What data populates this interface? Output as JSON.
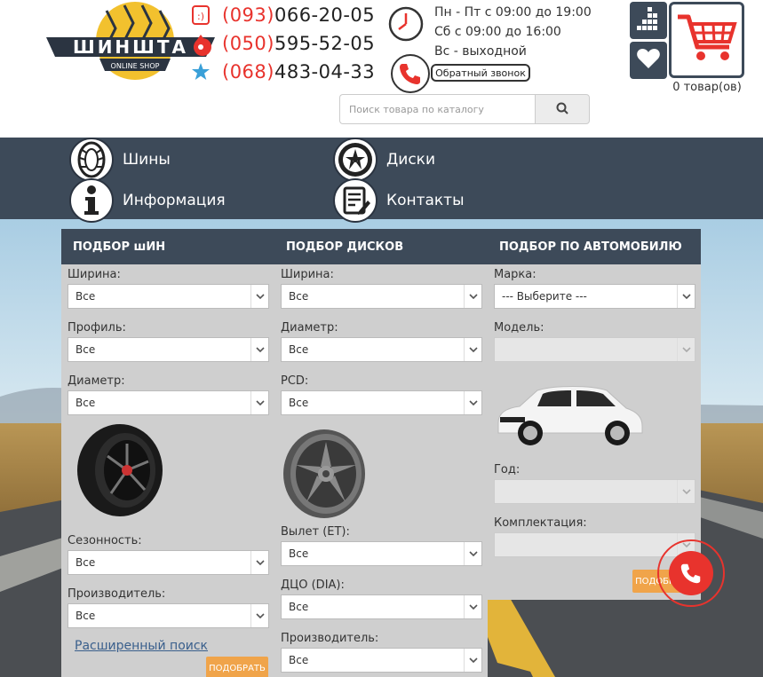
{
  "header": {
    "logo": {
      "text": "ШИНШТА",
      "subtitle": "ONLINE SHOP"
    },
    "phones": [
      {
        "code": "(093)",
        "number": "066-20-05",
        "icon": "smile-icon"
      },
      {
        "code": "(050)",
        "number": "595-52-05",
        "icon": "drop-icon"
      },
      {
        "code": "(068)",
        "number": "483-04-33",
        "icon": "star-icon"
      }
    ],
    "hours": [
      "Пн - Пт с 09:00 до 19:00",
      "Сб с 09:00 до 16:00",
      "Вс - выходной"
    ],
    "callback_label": "Обратный звонок",
    "cart_count_label": "0 товар(ов)",
    "search_placeholder": "Поиск товара по каталогу",
    "colors": {
      "accent": "#e8332d",
      "nav": "#3d4a59"
    }
  },
  "nav": {
    "items": [
      {
        "label": "Шины",
        "icon": "tire-icon"
      },
      {
        "label": "Диски",
        "icon": "wheel-rim-icon"
      },
      {
        "label": "Информация",
        "icon": "info-icon"
      },
      {
        "label": "Контакты",
        "icon": "contacts-icon"
      }
    ]
  },
  "tires": {
    "title": "ПОДБОР шИН",
    "width": {
      "label": "Ширина:",
      "value": "Все"
    },
    "profile": {
      "label": "Профиль:",
      "value": "Все"
    },
    "diameter": {
      "label": "Диаметр:",
      "value": "Все"
    },
    "season": {
      "label": "Сезонность:",
      "value": "Все"
    },
    "maker": {
      "label": "Производитель:",
      "value": "Все"
    },
    "advanced_link": "Расширенный поиск",
    "button": "ПОДОБРАТЬ"
  },
  "rims": {
    "title": "ПОДБОР ДИСКОВ",
    "width": {
      "label": "Ширина:",
      "value": "Все"
    },
    "diameter": {
      "label": "Диаметр:",
      "value": "Все"
    },
    "pcd": {
      "label": "PCD:",
      "value": "Все"
    },
    "et": {
      "label": "Вылет (ET):",
      "value": "Все"
    },
    "dia": {
      "label": "ДЦО (DIA):",
      "value": "Все"
    },
    "maker": {
      "label": "Производитель:",
      "value": "Все"
    }
  },
  "car": {
    "title": "ПОДБОР ПО АВТОМОБИЛЮ",
    "brand": {
      "label": "Марка:",
      "value": "--- Выберите ---"
    },
    "model": {
      "label": "Модель:",
      "value": ""
    },
    "year": {
      "label": "Год:",
      "value": ""
    },
    "trim": {
      "label": "Комплектация:",
      "value": ""
    },
    "button": "ПОДОБРАТЬ"
  }
}
